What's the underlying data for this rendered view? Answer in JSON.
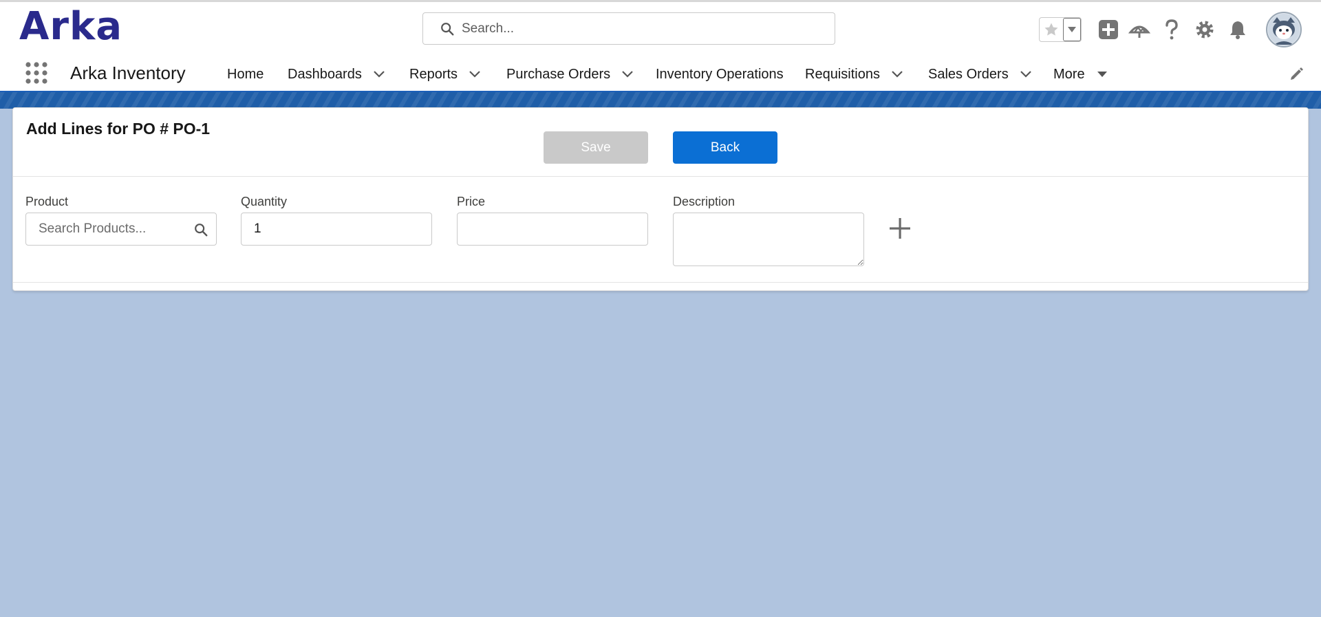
{
  "header": {
    "logo_text": "Arka",
    "search_placeholder": "Search..."
  },
  "nav": {
    "app_name": "Arka Inventory",
    "items": [
      {
        "label": "Home",
        "has_dropdown": false
      },
      {
        "label": "Dashboards",
        "has_dropdown": true
      },
      {
        "label": "Reports",
        "has_dropdown": true
      },
      {
        "label": "Purchase Orders",
        "has_dropdown": true
      },
      {
        "label": "Inventory Operations",
        "has_dropdown": false
      },
      {
        "label": "Requisitions",
        "has_dropdown": true
      },
      {
        "label": "Sales Orders",
        "has_dropdown": true
      },
      {
        "label": "More",
        "has_dropdown": true
      }
    ]
  },
  "card": {
    "title": "Add Lines for PO # PO-1",
    "save_label": "Save",
    "back_label": "Back"
  },
  "form": {
    "product_label": "Product",
    "product_placeholder": "Search Products...",
    "quantity_label": "Quantity",
    "quantity_value": "1",
    "price_label": "Price",
    "price_value": "",
    "description_label": "Description",
    "description_value": ""
  },
  "colors": {
    "brand": "#2a2a8c",
    "primary_button": "#0b6fd4",
    "disabled_button": "#c9c9c9",
    "page_background": "#b0c4df",
    "band": "#1f5ea8"
  },
  "icons": {
    "search": "search-icon",
    "favorite": "star-icon",
    "favorites_menu": "caret-down-icon",
    "new": "plus-square-icon",
    "trailhead": "trailhead-icon",
    "help": "help-icon",
    "setup": "gear-icon",
    "notifications": "bell-icon",
    "app_launcher": "waffle-icon",
    "edit_nav": "pencil-icon",
    "add_line": "plus-icon"
  }
}
